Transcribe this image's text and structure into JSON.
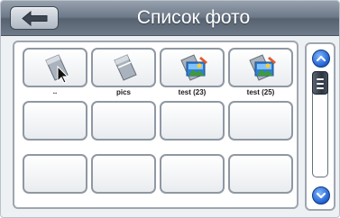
{
  "header": {
    "title": "Список фото",
    "back_icon": "arrow-left-icon"
  },
  "grid": {
    "items": [
      {
        "label": "..",
        "icon": "folder-up-icon"
      },
      {
        "label": "pics",
        "icon": "folder-icon"
      },
      {
        "label": "test (23)",
        "icon": "photo-folder-icon"
      },
      {
        "label": "test (25)",
        "icon": "photo-folder-icon"
      }
    ],
    "empty_slots": 8
  },
  "scrollbar": {
    "up_icon": "chevron-up-icon",
    "down_icon": "chevron-down-icon",
    "thumb_icon": "grip-icon"
  },
  "colors": {
    "header": "#6c7888",
    "accent": "#1f5fd0",
    "border": "#8f98a3"
  }
}
